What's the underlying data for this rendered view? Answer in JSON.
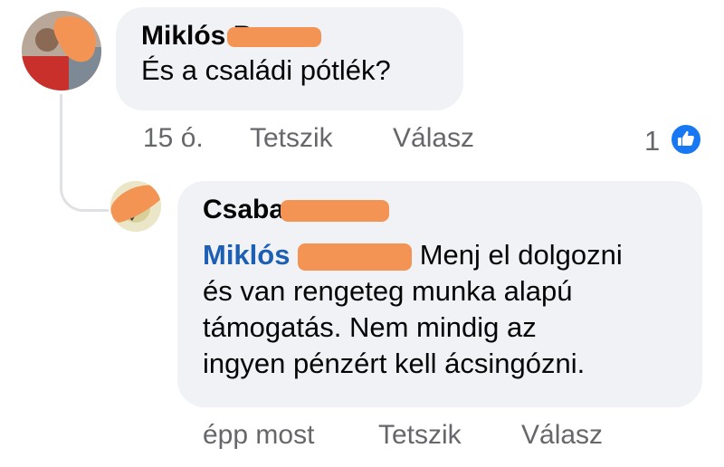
{
  "comment1": {
    "author_name": "Miklós B",
    "text": "És a családi pótlék?",
    "time": "15 ó.",
    "like_label": "Tetszik",
    "reply_label": "Válasz",
    "reaction_count": "1",
    "reaction_icon": "like-icon"
  },
  "comment2": {
    "author_name": "Csaba",
    "mention": "Miklós",
    "text_line1": "Menj el dolgozni",
    "text_line2": "és van rengeteg munka alapú",
    "text_line3": "támogatás. Nem mindig az",
    "text_line4": "ingyen pénzért kell ácsingózni.",
    "time": "épp most",
    "like_label": "Tetszik",
    "reply_label": "Válasz"
  },
  "colors": {
    "bubble_bg": "#f0f2f5",
    "meta_text": "#65676b",
    "mention": "#1d5fb3",
    "like_blue": "#1877f2",
    "redaction": "#f39454"
  }
}
